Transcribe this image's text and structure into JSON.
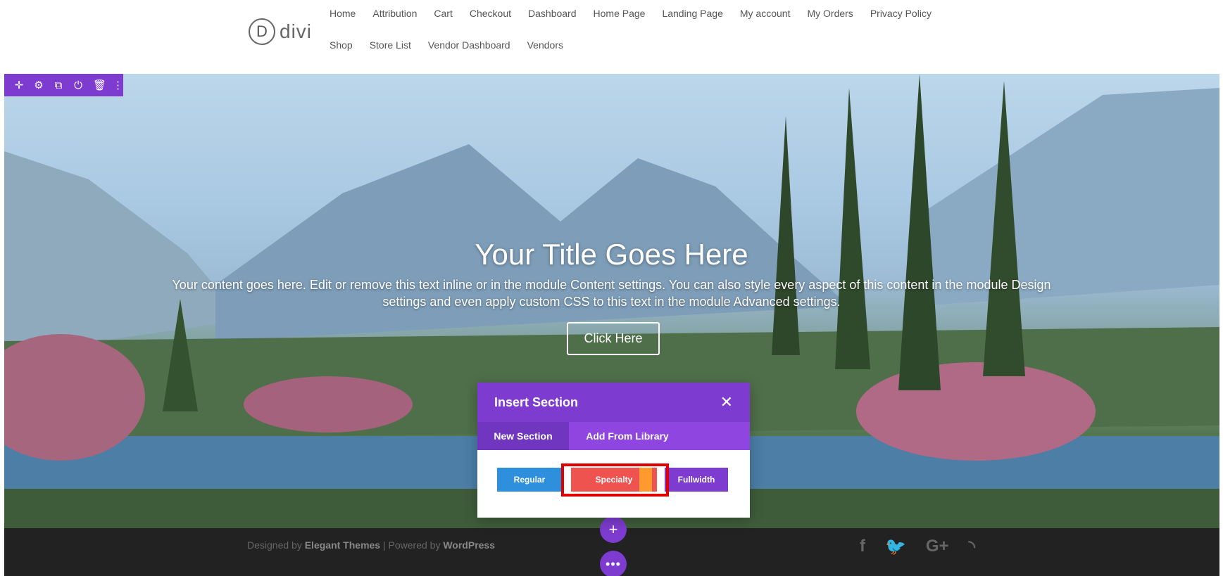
{
  "header": {
    "logo_letter": "D",
    "logo_word": "divi",
    "nav_row_1": [
      "Home",
      "Attribution",
      "Cart",
      "Checkout",
      "Dashboard",
      "Home Page",
      "Landing Page",
      "My account",
      "My Orders",
      "Privacy Policy"
    ],
    "nav_row_2": [
      "Shop",
      "Store List",
      "Vendor Dashboard",
      "Vendors"
    ]
  },
  "hero": {
    "title": "Your Title Goes Here",
    "body": "Your content goes here. Edit or remove this text inline or in the module Content settings. You can also style every aspect of this content in the module Design settings and even apply custom CSS to this text in the module Advanced settings.",
    "button_label": "Click Here"
  },
  "section_toolbar": {
    "icons": [
      "move-icon",
      "settings-icon",
      "duplicate-icon",
      "power-icon",
      "trash-icon",
      "more-vertical-icon"
    ],
    "glyphs": [
      "✛",
      "⚙",
      "⧉",
      "⏻",
      "🗑",
      "⋮"
    ]
  },
  "modal": {
    "title": "Insert Section",
    "close_glyph": "✕",
    "tabs": [
      "New Section",
      "Add From Library"
    ],
    "options": {
      "regular": "Regular",
      "specialty": "Specialty",
      "fullwidth": "Fullwidth"
    }
  },
  "footer": {
    "designed_by": "Designed by",
    "elegant_themes": "Elegant Themes",
    "separator": "|",
    "powered_by": "Powered by",
    "wordpress": "WordPress",
    "social": [
      "f",
      "🐦",
      "G+",
      "◝"
    ]
  },
  "buttons": {
    "add": "+",
    "more": "•••"
  },
  "colors": {
    "divi_purple": "#7e3bd0",
    "regular_blue": "#2e8fdd",
    "specialty_red": "#ef5350",
    "specialty_orange": "#ff9a2e",
    "highlight_red": "#e00000",
    "footer_bg": "#222222"
  }
}
